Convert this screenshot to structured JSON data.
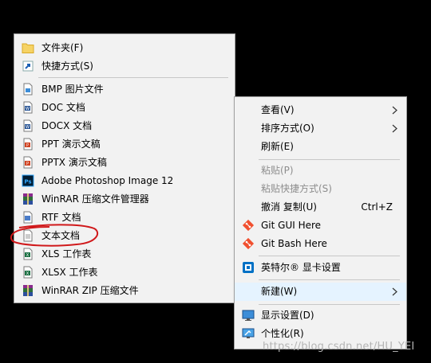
{
  "new_submenu": {
    "items": [
      {
        "label": "文件夹(F)",
        "icon": "folder-icon"
      },
      {
        "label": "快捷方式(S)",
        "icon": "shortcut-icon"
      },
      {
        "label": "BMP 图片文件",
        "icon": "bmp-file-icon"
      },
      {
        "label": "DOC 文档",
        "icon": "doc-file-icon"
      },
      {
        "label": "DOCX 文档",
        "icon": "docx-file-icon"
      },
      {
        "label": "PPT 演示文稿",
        "icon": "ppt-file-icon"
      },
      {
        "label": "PPTX 演示文稿",
        "icon": "pptx-file-icon"
      },
      {
        "label": "Adobe Photoshop Image 12",
        "icon": "photoshop-file-icon"
      },
      {
        "label": "WinRAR 压缩文件管理器",
        "icon": "winrar-archive-icon"
      },
      {
        "label": "RTF 文档",
        "icon": "rtf-file-icon"
      },
      {
        "label": "文本文档",
        "icon": "text-file-icon"
      },
      {
        "label": "XLS 工作表",
        "icon": "xls-file-icon"
      },
      {
        "label": "XLSX 工作表",
        "icon": "xlsx-file-icon"
      },
      {
        "label": "WinRAR ZIP 压缩文件",
        "icon": "winrar-zip-icon"
      }
    ]
  },
  "context_menu": {
    "items": [
      {
        "label": "查看(V)",
        "has_submenu": true
      },
      {
        "label": "排序方式(O)",
        "has_submenu": true
      },
      {
        "label": "刷新(E)"
      },
      {
        "label": "粘贴(P)",
        "disabled": true
      },
      {
        "label": "粘贴快捷方式(S)",
        "disabled": true
      },
      {
        "label": "撤消 复制(U)",
        "shortcut": "Ctrl+Z"
      },
      {
        "label": "Git GUI Here",
        "icon": "git-icon"
      },
      {
        "label": "Git Bash Here",
        "icon": "git-icon"
      },
      {
        "label": "英特尔® 显卡设置",
        "icon": "intel-graphics-icon"
      },
      {
        "label": "新建(W)",
        "has_submenu": true,
        "highlighted": true
      },
      {
        "label": "显示设置(D)",
        "icon": "display-settings-icon"
      },
      {
        "label": "个性化(R)",
        "icon": "personalize-icon"
      }
    ]
  },
  "watermark": "https://blog.csdn.net/HU_YEI",
  "colors": {
    "background": "#000000",
    "menu_bg": "#f2f2f2",
    "disabled_text": "#8d8d8d",
    "annotation": "#d0191b"
  }
}
